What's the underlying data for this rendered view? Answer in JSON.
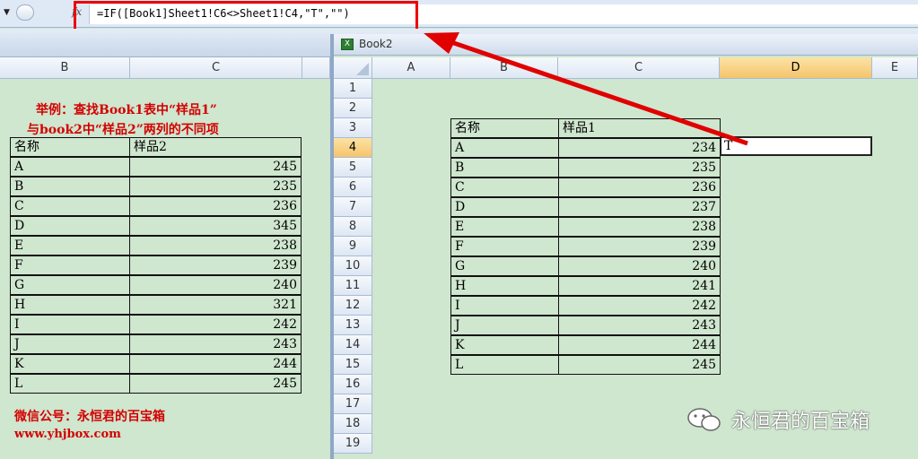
{
  "formula_bar": {
    "fx": "fx",
    "formula": "=IF([Book1]Sheet1!C6<>Sheet1!C4,\"T\",\"\")"
  },
  "left": {
    "columns": [
      "B",
      "C"
    ],
    "note_line1": "举例：查找Book1表中“样品1”",
    "note_line2": "与book2中“样品2”两列的不同项",
    "header": [
      "名称",
      "样品2"
    ],
    "rows": [
      [
        "A",
        "245"
      ],
      [
        "B",
        "235"
      ],
      [
        "C",
        "236"
      ],
      [
        "D",
        "345"
      ],
      [
        "E",
        "238"
      ],
      [
        "F",
        "239"
      ],
      [
        "G",
        "240"
      ],
      [
        "H",
        "321"
      ],
      [
        "I",
        "242"
      ],
      [
        "J",
        "243"
      ],
      [
        "K",
        "244"
      ],
      [
        "L",
        "245"
      ]
    ],
    "footer1": "微信公号：永恒君的百宝箱",
    "footer2": "www.yhjbox.com"
  },
  "window": {
    "title": "Book2",
    "columns": [
      "A",
      "B",
      "C",
      "D",
      "E"
    ],
    "row_numbers": [
      "1",
      "2",
      "3",
      "4",
      "5",
      "6",
      "7",
      "8",
      "9",
      "10",
      "11",
      "12",
      "13",
      "14",
      "15",
      "16",
      "17",
      "18",
      "19"
    ],
    "header": [
      "名称",
      "样品1"
    ],
    "rows": [
      [
        "A",
        "234"
      ],
      [
        "B",
        "235"
      ],
      [
        "C",
        "236"
      ],
      [
        "D",
        "237"
      ],
      [
        "E",
        "238"
      ],
      [
        "F",
        "239"
      ],
      [
        "G",
        "240"
      ],
      [
        "H",
        "241"
      ],
      [
        "I",
        "242"
      ],
      [
        "J",
        "243"
      ],
      [
        "K",
        "244"
      ],
      [
        "L",
        "245"
      ]
    ],
    "selected_value": "T"
  },
  "watermark": "永恒君的百宝箱",
  "colors": {
    "annotation": "#e00000",
    "grid": "#cfe6cf",
    "selected_header": "#f5c46b"
  }
}
